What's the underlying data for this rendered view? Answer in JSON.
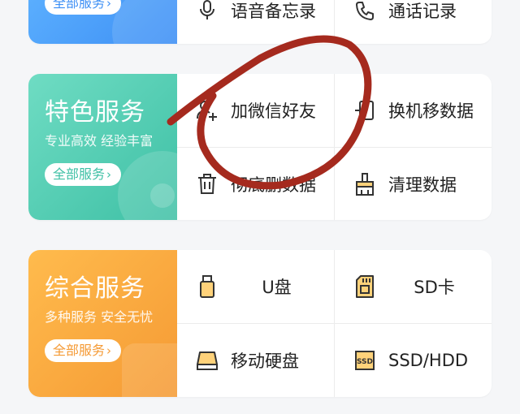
{
  "card1": {
    "pill_label": "全部服务",
    "items": [
      {
        "label": "语音备忘录",
        "icon": "microphone-icon"
      },
      {
        "label": "通话记录",
        "icon": "phone-icon"
      }
    ]
  },
  "card2": {
    "title": "特色服务",
    "subtitle": "专业高效 经验丰富",
    "pill_label": "全部服务",
    "accent": "#46c5ac",
    "items": [
      {
        "label": "加微信好友",
        "icon": "add-user-icon"
      },
      {
        "label": "换机移数据",
        "icon": "phone-transfer-icon"
      },
      {
        "label": "彻底删数据",
        "icon": "trash-icon"
      },
      {
        "label": "清理数据",
        "icon": "brush-icon"
      }
    ]
  },
  "card3": {
    "title": "综合服务",
    "subtitle": "多种服务 安全无忧",
    "pill_label": "全部服务",
    "accent": "#f5a43a",
    "items": [
      {
        "label": "U盘",
        "icon": "usb-drive-icon"
      },
      {
        "label": "SD卡",
        "icon": "sd-card-icon"
      },
      {
        "label": "移动硬盘",
        "icon": "external-hdd-icon"
      },
      {
        "label": "SSD/HDD",
        "icon": "ssd-icon"
      }
    ]
  },
  "annotation": {
    "color": "#a52a1e",
    "icon": "red-circle-annotation"
  }
}
